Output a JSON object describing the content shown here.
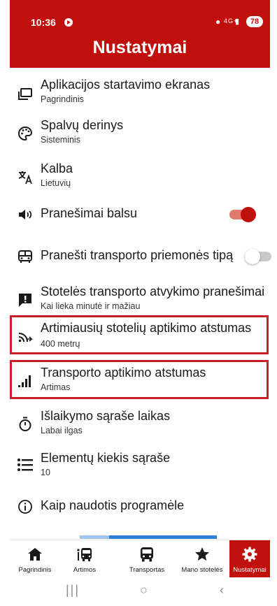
{
  "status": {
    "time": "10:36",
    "network": "4G+",
    "battery": "78"
  },
  "header": {
    "title": "Nustatymai"
  },
  "settings": [
    {
      "label": "Aplikacijos startavimo ekranas",
      "sub": "Pagrindinis",
      "icon": "window-icon"
    },
    {
      "label": "Spalvų derinys",
      "sub": "Sisteminis",
      "icon": "palette-icon"
    },
    {
      "label": "Kalba",
      "sub": "Lietuvių",
      "icon": "translate-icon"
    },
    {
      "label": "Pranešimai balsu",
      "icon": "speaker-icon",
      "toggle": true
    },
    {
      "label": "Pranešti transporto priemonės tipą",
      "icon": "bus-icon",
      "toggle": false
    },
    {
      "label": "Stotelės transporto atvykimo pranešimai",
      "sub": "Kai lieka minutė ir mažiau",
      "icon": "alert-icon"
    },
    {
      "label": "Artimiausių stotelių aptikimo atstumas",
      "sub": "400 metrų",
      "icon": "cast-icon",
      "highlighted": true
    },
    {
      "label": "Transporto aptikimo atstumas",
      "sub": "Artimas",
      "icon": "signal-bars-icon",
      "highlighted": true
    },
    {
      "label": "Išlaikymo sąraše laikas",
      "sub": "Labai ilgas",
      "icon": "timer-icon"
    },
    {
      "label": "Elementų kiekis sąraše",
      "sub": "10",
      "icon": "list-icon"
    },
    {
      "label": "Kaip naudotis programėle",
      "icon": "info-icon"
    }
  ],
  "nav": [
    {
      "label": "Pagrindinis",
      "icon": "home-icon"
    },
    {
      "label": "Artimos",
      "icon": "nearby-bus-icon"
    },
    {
      "label": "Transportas",
      "icon": "bus-front-icon"
    },
    {
      "label": "Mano stotelės",
      "icon": "star-icon"
    },
    {
      "label": "Nustatymai",
      "icon": "settings-icon",
      "active": true
    }
  ],
  "colors": {
    "brand": "#c0100b",
    "highlight_border": "#c8202a",
    "text": "#1a1a1a"
  }
}
